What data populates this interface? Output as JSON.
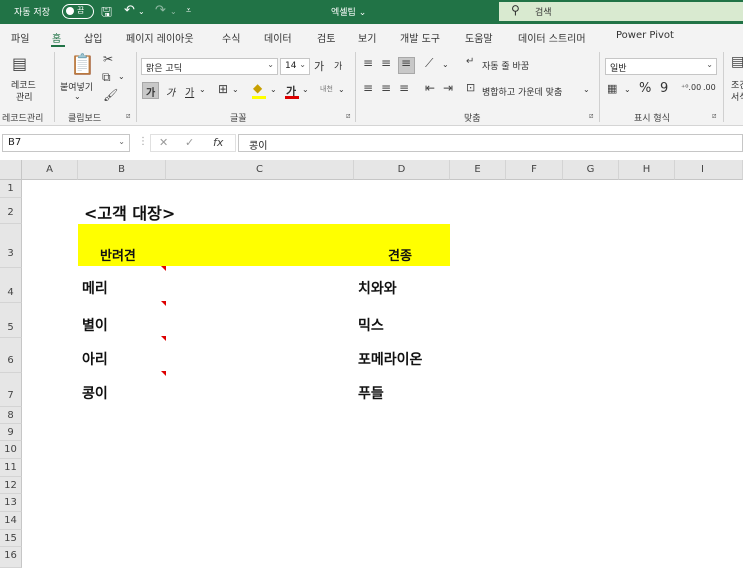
{
  "titlebar": {
    "autosave_label": "자동 저장",
    "autosave_state": "끔",
    "doc_title": "엑셀팁 ⌄",
    "search_placeholder": "검색"
  },
  "tabs": [
    "파일",
    "홈",
    "삽입",
    "페이지 레이아웃",
    "수식",
    "데이터",
    "검토",
    "보기",
    "개발 도구",
    "도움말",
    "데이터 스트리머",
    "Power Pivot"
  ],
  "active_tab": "홈",
  "ribbon": {
    "record_macro_label_1": "레코드",
    "record_macro_label_2": "관리",
    "group_record": "레코드관리",
    "paste_label": "붙여넣기",
    "group_clipboard": "클립보드",
    "font_name": "맑은 고딕",
    "font_size": "14",
    "grow_font": "가",
    "shrink_font": "가",
    "bold": "가",
    "italic": "가",
    "underline": "가",
    "group_font": "글꼴",
    "wrap_text": "자동 줄 바꿈",
    "merge_center": "병합하고 가운데 맞춤",
    "group_alignment": "맞춤",
    "number_format": "일반",
    "group_number": "표시 형식",
    "percent": "%",
    "comma": "9",
    "cond_label": "조건",
    "cond_label_2": "서식"
  },
  "formula_bar": {
    "name_box": "B7",
    "fx": "fx",
    "formula": "콩이"
  },
  "columns": [
    "A",
    "B",
    "C",
    "D",
    "E",
    "F",
    "G",
    "H",
    "I"
  ],
  "rows": [
    "1",
    "2",
    "3",
    "4",
    "5",
    "6",
    "7",
    "8",
    "9",
    "10",
    "11",
    "12",
    "13",
    "14",
    "15",
    "16"
  ],
  "sheet": {
    "title": "<고객 대장>",
    "header_pet": "반려견",
    "header_breed": "견종",
    "fill_color": "#ffff00",
    "records": [
      {
        "name": "메리",
        "breed": "치와와"
      },
      {
        "name": "별이",
        "breed": "믹스"
      },
      {
        "name": "아리",
        "breed": "포메라이온"
      },
      {
        "name": "콩이",
        "breed": "푸들"
      }
    ]
  },
  "colors": {
    "excel_green": "#217346",
    "note_red": "#dd0000"
  }
}
